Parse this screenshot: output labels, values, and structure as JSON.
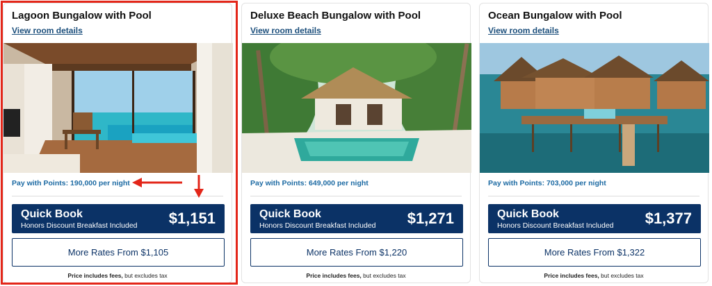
{
  "colors": {
    "highlight": "#e32619",
    "quick_book_bg": "#0b3266",
    "points_text": "#1c6aa3",
    "link_text": "#1c4f7c"
  },
  "rooms": [
    {
      "title": "Lagoon Bungalow with Pool",
      "details_link": "View room details",
      "points": "Pay with Points: 190,000 per night",
      "quick_book": {
        "label": "Quick Book",
        "sub": "Honors Discount Breakfast Included",
        "price": "$1,151"
      },
      "more_rates": "More Rates From $1,105",
      "fees_bold": "Price includes fees,",
      "fees_rest": " but excludes tax"
    },
    {
      "title": "Deluxe Beach Bungalow with Pool",
      "details_link": "View room details",
      "points": "Pay with Points: 649,000 per night",
      "quick_book": {
        "label": "Quick Book",
        "sub": "Honors Discount Breakfast Included",
        "price": "$1,271"
      },
      "more_rates": "More Rates From $1,220",
      "fees_bold": "Price includes fees,",
      "fees_rest": " but excludes tax"
    },
    {
      "title": "Ocean Bungalow with Pool",
      "details_link": "View room details",
      "points": "Pay with Points: 703,000 per night",
      "quick_book": {
        "label": "Quick Book",
        "sub": "Honors Discount Breakfast Included",
        "price": "$1,377"
      },
      "more_rates": "More Rates From $1,322",
      "fees_bold": "Price includes fees,",
      "fees_rest": " but excludes tax"
    }
  ]
}
